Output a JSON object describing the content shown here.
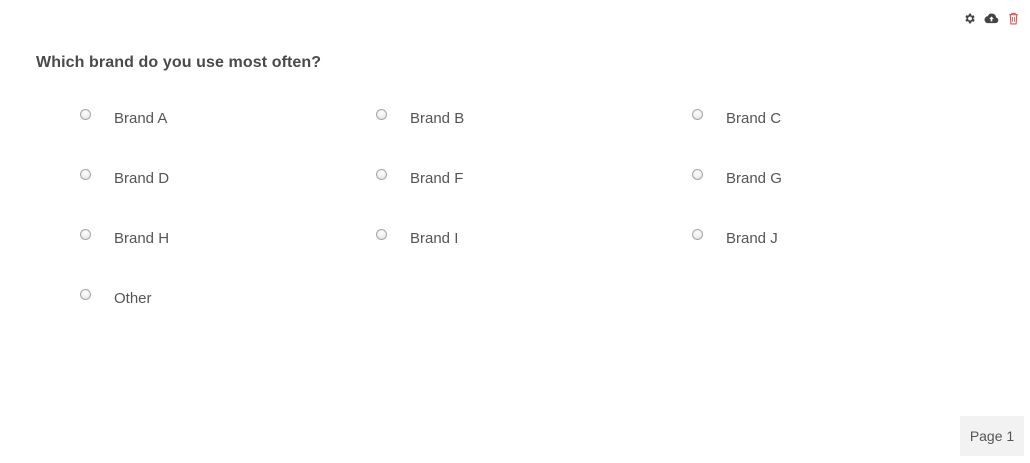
{
  "toolbar": {
    "icons": [
      "gear-icon",
      "cloud-upload-icon",
      "trash-icon"
    ],
    "colors": {
      "default": "#444444",
      "delete": "#d9534f"
    }
  },
  "question": {
    "text": "Which brand do you use most often?",
    "options": [
      {
        "label": "Brand A",
        "selected": false
      },
      {
        "label": "Brand B",
        "selected": false
      },
      {
        "label": "Brand C",
        "selected": false
      },
      {
        "label": "Brand D",
        "selected": false
      },
      {
        "label": "Brand F",
        "selected": false
      },
      {
        "label": "Brand G",
        "selected": false
      },
      {
        "label": "Brand H",
        "selected": false
      },
      {
        "label": "Brand I",
        "selected": false
      },
      {
        "label": "Brand J",
        "selected": false
      },
      {
        "label": "Other",
        "selected": false
      }
    ]
  },
  "footer": {
    "page_label": "Page 1"
  }
}
